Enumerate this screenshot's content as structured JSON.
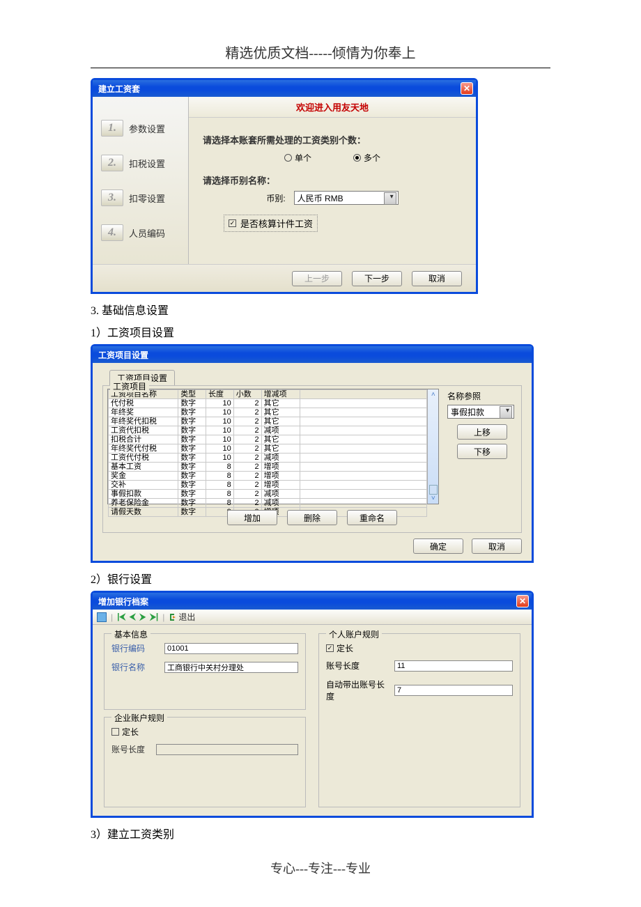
{
  "doc": {
    "header": "精选优质文档-----倾情为你奉上",
    "footer": "专心---专注---专业",
    "sec3": "3. 基础信息设置",
    "sec3_1": "1）工资项目设置",
    "sec3_2": "2）银行设置",
    "sec3_3": "3）建立工资类别"
  },
  "win1": {
    "title": "建立工资套",
    "welcome": "欢迎进入用友天地",
    "steps": [
      {
        "n": "1.",
        "label": "参数设置"
      },
      {
        "n": "2.",
        "label": "扣税设置"
      },
      {
        "n": "3.",
        "label": "扣零设置"
      },
      {
        "n": "4.",
        "label": "人员编码"
      }
    ],
    "q1": "请选择本账套所需处理的工资类别个数：",
    "r1": "单个",
    "r2": "多个",
    "q2": "请选择币别名称：",
    "cur_label": "币别:",
    "cur_value": "人民币 RMB",
    "chk": "是否核算计件工资",
    "prev": "上一步",
    "next": "下一步",
    "cancel": "取消"
  },
  "win2": {
    "title": "工资项目设置",
    "tab": "工资项目设置",
    "group": "工资项目",
    "cols": [
      "工资项目名称",
      "类型",
      "长度",
      "小数",
      "增减项"
    ],
    "rows": [
      [
        "代付税",
        "数字",
        "10",
        "2",
        "其它"
      ],
      [
        "年终奖",
        "数字",
        "10",
        "2",
        "其它"
      ],
      [
        "年终奖代扣税",
        "数字",
        "10",
        "2",
        "其它"
      ],
      [
        "工资代扣税",
        "数字",
        "10",
        "2",
        "减项"
      ],
      [
        "扣税合计",
        "数字",
        "10",
        "2",
        "其它"
      ],
      [
        "年终奖代付税",
        "数字",
        "10",
        "2",
        "其它"
      ],
      [
        "工资代付税",
        "数字",
        "10",
        "2",
        "减项"
      ],
      [
        "基本工资",
        "数字",
        "8",
        "2",
        "增项"
      ],
      [
        "奖金",
        "数字",
        "8",
        "2",
        "增项"
      ],
      [
        "交补",
        "数字",
        "8",
        "2",
        "增项"
      ],
      [
        "事假扣款",
        "数字",
        "8",
        "2",
        "减项"
      ],
      [
        "养老保险金",
        "数字",
        "8",
        "2",
        "减项"
      ],
      [
        "请假天数",
        "数字",
        "8",
        "2",
        "增项"
      ]
    ],
    "ref_label": "名称参照",
    "ref_value": "事假扣款",
    "up": "上移",
    "down": "下移",
    "add": "增加",
    "del": "删除",
    "rename": "重命名",
    "ok": "确定",
    "cancel": "取消"
  },
  "win3": {
    "title": "增加银行档案",
    "exit": "退出",
    "g_basic": "基本信息",
    "code_lbl": "银行编码",
    "code_val": "01001",
    "name_lbl": "银行名称",
    "name_val": "工商银行中关村分理处",
    "g_corp": "企业账户规则",
    "corp_fixed": "定长",
    "corp_len": "账号长度",
    "g_pers": "个人账户规则",
    "pers_fixed": "定长",
    "pers_len_lbl": "账号长度",
    "pers_len_val": "11",
    "auto_lbl": "自动带出账号长度",
    "auto_val": "7"
  }
}
